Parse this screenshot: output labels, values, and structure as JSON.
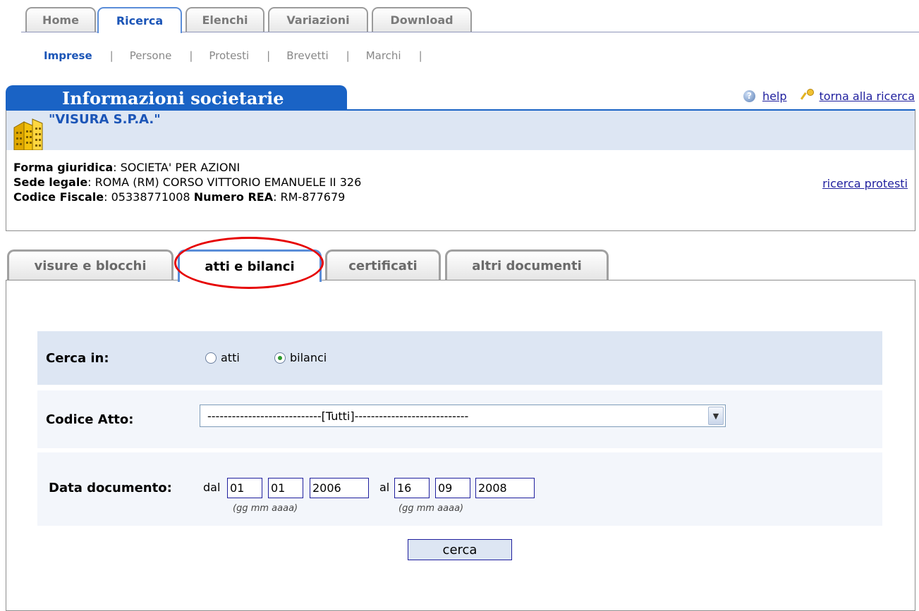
{
  "top_tabs": [
    "Home",
    "Ricerca",
    "Elenchi",
    "Variazioni",
    "Download"
  ],
  "sub_nav": [
    "Imprese",
    "Persone",
    "Protesti",
    "Brevetti",
    "Marchi"
  ],
  "separator": "|",
  "header": {
    "title": "Informazioni societarie",
    "help_link": "help",
    "back_link": "torna alla ricerca"
  },
  "company": {
    "name": "\"VISURA S.P.A.\"",
    "forma_label": "Forma giuridica",
    "forma_value": ": SOCIETA' PER AZIONI",
    "sede_label": "Sede legale",
    "sede_value": ": ROMA (RM) CORSO VITTORIO EMANUELE II 326",
    "cf_label": "Codice Fiscale",
    "cf_value": ": 05338771008 ",
    "rea_label": "Numero REA",
    "rea_value": ": RM-877679",
    "protesti_link": "ricerca protesti"
  },
  "doc_tabs": [
    "visure e blocchi",
    "atti e bilanci",
    "certificati",
    "altri documenti"
  ],
  "form": {
    "cerca_in_label": "Cerca in:",
    "option_atti": "atti",
    "option_bilanci": "bilanci",
    "selected_option": "bilanci",
    "codice_label": "Codice Atto:",
    "codice_value": "----------------------------[Tutti]----------------------------",
    "data_label": "Data documento:",
    "dal": "dal",
    "al": "al",
    "from_gg": "01",
    "from_mm": "01",
    "from_aaaa": "2006",
    "to_gg": "16",
    "to_mm": "09",
    "to_aaaa": "2008",
    "format_hint": "(gg mm aaaa)",
    "submit": "cerca"
  },
  "colors": {
    "accent": "#1a63c5",
    "active_text": "#1b55b7",
    "highlight_circle": "#e60000",
    "row_bg": "#dde6f3"
  }
}
